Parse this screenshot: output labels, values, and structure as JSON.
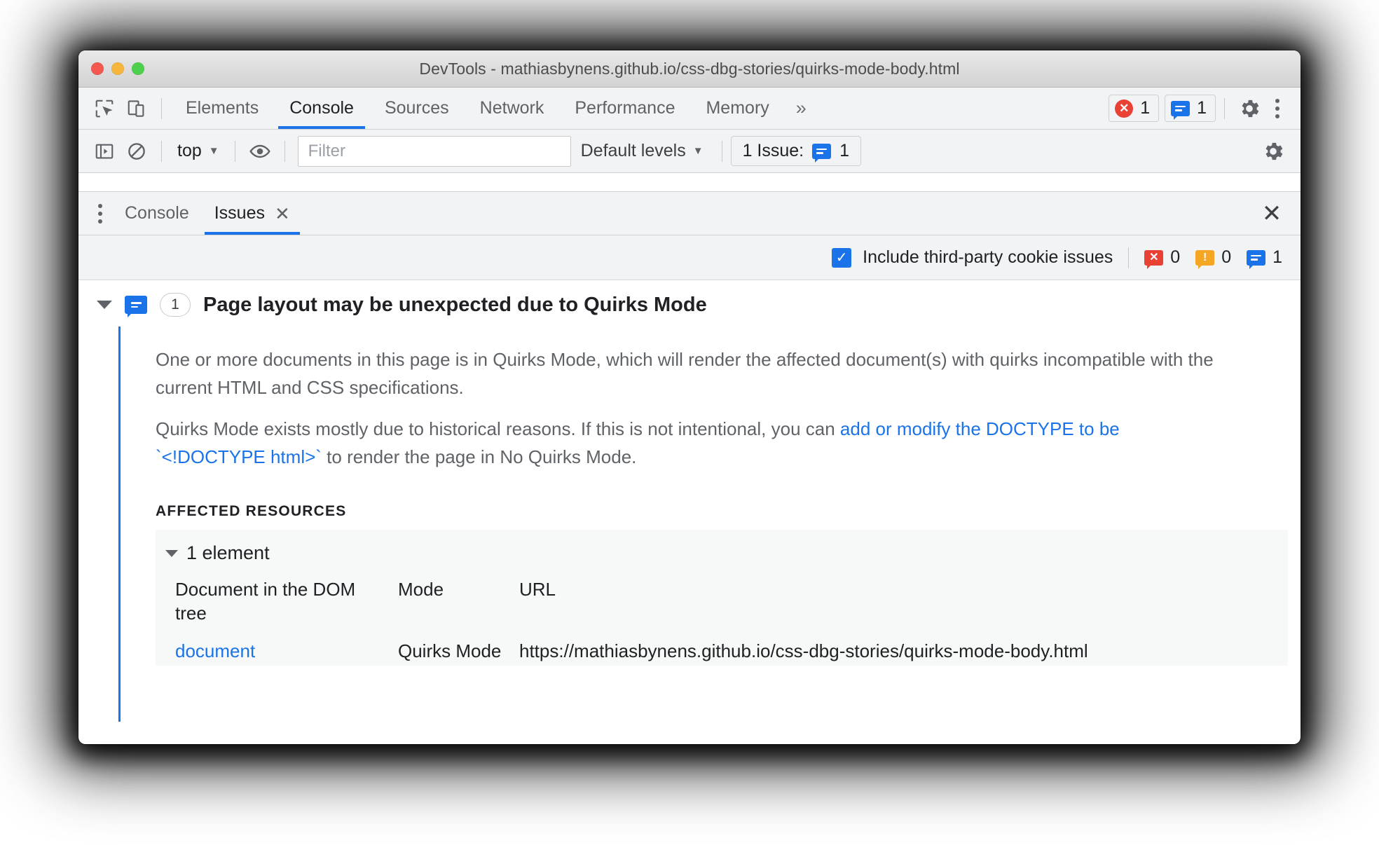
{
  "window": {
    "title": "DevTools - mathiasbynens.github.io/css-dbg-stories/quirks-mode-body.html",
    "traffic_lights": [
      "close",
      "minimize",
      "zoom"
    ]
  },
  "main_toolbar": {
    "inspect_icon": "inspect-element-icon",
    "device_icon": "device-toolbar-icon",
    "tabs": [
      {
        "label": "Elements",
        "active": false
      },
      {
        "label": "Console",
        "active": true
      },
      {
        "label": "Sources",
        "active": false
      },
      {
        "label": "Network",
        "active": false
      },
      {
        "label": "Performance",
        "active": false
      },
      {
        "label": "Memory",
        "active": false
      }
    ],
    "more_tabs": "»",
    "error_count": "1",
    "issue_count": "1",
    "settings_icon": "gear-icon",
    "menu_icon": "kebab-menu-icon"
  },
  "console_toolbar": {
    "sidebar_icon": "console-sidebar-icon",
    "clear_icon": "clear-console-icon",
    "context": "top",
    "eye_icon": "live-expression-icon",
    "filter_placeholder": "Filter",
    "filter_value": "",
    "levels": "Default levels",
    "issues_button": "1 Issue:",
    "issues_button_count": "1",
    "settings_icon": "gear-icon"
  },
  "drawer": {
    "menu_icon": "kebab-menu-icon",
    "tabs": [
      {
        "label": "Console",
        "active": false,
        "closable": false
      },
      {
        "label": "Issues",
        "active": true,
        "closable": true
      }
    ],
    "close_icon": "close-drawer-icon"
  },
  "issues_filter": {
    "checkbox_label": "Include third-party cookie issues",
    "checkbox_checked": true,
    "error_count": "0",
    "warning_count": "0",
    "info_count": "1"
  },
  "issue": {
    "expanded": true,
    "kind_icon": "issue-info-bubble-icon",
    "count": "1",
    "title": "Page layout may be unexpected due to Quirks Mode",
    "paragraph1": "One or more documents in this page is in Quirks Mode, which will render the affected document(s) with quirks incompatible with the current HTML and CSS specifications.",
    "paragraph2_prefix": "Quirks Mode exists mostly due to historical reasons. If this is not intentional, you can ",
    "paragraph2_link": "add or modify the DOCTYPE to be `<!DOCTYPE html>`",
    "paragraph2_suffix": " to render the page in No Quirks Mode.",
    "affected_resources_label": "AFFECTED RESOURCES",
    "resource_group_label": "1 element",
    "resource_group_expanded": true,
    "table": {
      "headers": [
        "Document in the DOM tree",
        "Mode",
        "URL"
      ],
      "rows": [
        {
          "element": "document",
          "mode": "Quirks Mode",
          "url": "https://mathiasbynens.github.io/css-dbg-stories/quirks-mode-body.html"
        }
      ]
    }
  },
  "colors": {
    "accent_blue": "#1a73e8",
    "error_red": "#e94235",
    "warning_orange": "#f5a623",
    "toolbar_bg": "#f2f3f4"
  }
}
